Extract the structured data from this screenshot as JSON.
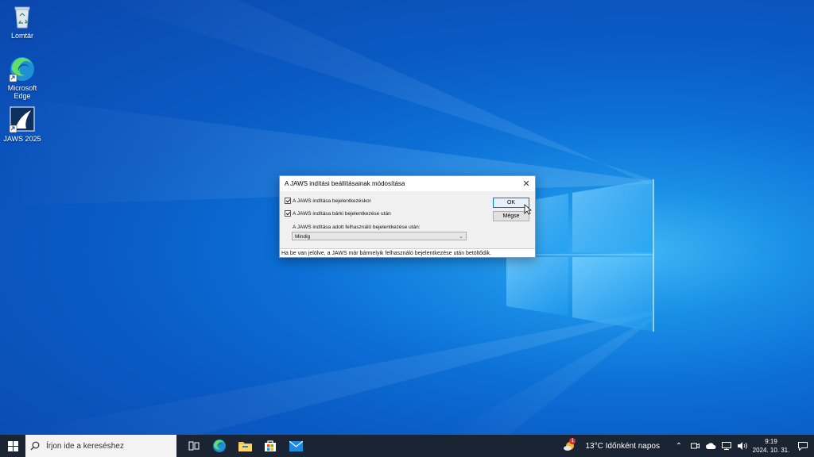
{
  "desktop": {
    "icons": [
      {
        "label": "Lomtár",
        "icon": "recycle-bin-icon"
      },
      {
        "label": "Microsoft Edge",
        "icon": "edge-icon"
      },
      {
        "label": "JAWS 2025",
        "icon": "jaws-icon"
      }
    ]
  },
  "dialog": {
    "title": "A JAWS indítási beállításainak módosítása",
    "close_label": "✕",
    "option1": {
      "label": "A JAWS indítása bejelentkezéskor",
      "checked": true
    },
    "option2": {
      "label": "A JAWS indítása bárki bejelentkezése után",
      "checked": true
    },
    "combo_label": "A JAWS indítása adott felhasználó bejelentkezése után:",
    "combo_value": "Mindig",
    "ok_label": "OK",
    "cancel_label": "Mégse",
    "status_text": "Ha be van jelölve, a JAWS már bármelyik felhasználó bejelentkezése után betöltődik."
  },
  "taskbar": {
    "search_placeholder": "Írjon ide a kereséshez",
    "weather_text": "13°C  Időnként napos",
    "weather_badge": "1",
    "time": "9:19",
    "date": "2024. 10. 31."
  },
  "colors": {
    "accent": "#0078d7",
    "taskbar": "#1b2433"
  }
}
